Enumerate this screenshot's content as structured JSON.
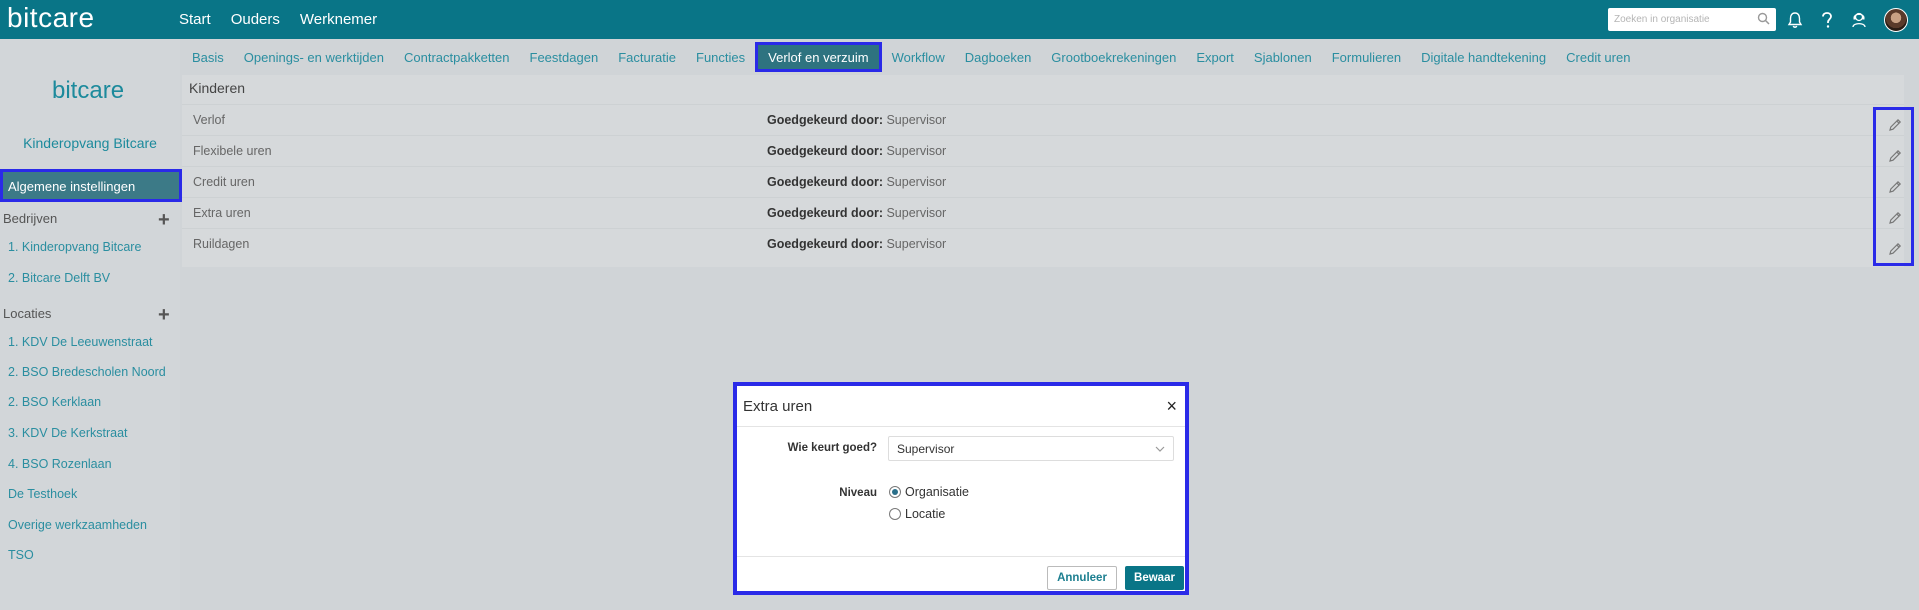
{
  "topbar": {
    "logo": "bitcare",
    "nav": [
      "Start",
      "Ouders",
      "Werknemer"
    ],
    "search_placeholder": "Zoeken in organisatie"
  },
  "sidebar": {
    "logo": "bitcare",
    "org_name": "Kinderopvang Bitcare",
    "settings_label": "Algemene instellingen",
    "companies_label": "Bedrijven",
    "companies": [
      "1. Kinderopvang Bitcare",
      "2. Bitcare Delft BV"
    ],
    "locations_label": "Locaties",
    "locations": [
      "1. KDV De Leeuwenstraat",
      "2. BSO Bredescholen Noord",
      "2. BSO Kerklaan",
      "3. KDV De Kerkstraat",
      "4. BSO Rozenlaan",
      "De Testhoek",
      "Overige werkzaamheden",
      "TSO"
    ]
  },
  "subnav": {
    "tabs": [
      "Basis",
      "Openings- en werktijden",
      "Contractpakketten",
      "Feestdagen",
      "Facturatie",
      "Functies",
      "Verlof en verzuim",
      "Workflow",
      "Dagboeken",
      "Grootboekrekeningen",
      "Export",
      "Sjablonen",
      "Formulieren",
      "Digitale handtekening",
      "Credit uren"
    ],
    "active_index": 6
  },
  "panel": {
    "heading": "Kinderen",
    "approved_label": "Goedgekeurd door:",
    "rows": [
      {
        "name": "Verlof",
        "approver": "Supervisor"
      },
      {
        "name": "Flexibele uren",
        "approver": "Supervisor"
      },
      {
        "name": "Credit uren",
        "approver": "Supervisor"
      },
      {
        "name": "Extra uren",
        "approver": "Supervisor"
      },
      {
        "name": "Ruildagen",
        "approver": "Supervisor"
      }
    ]
  },
  "modal": {
    "title": "Extra uren",
    "close": "×",
    "approver_label": "Wie keurt goed?",
    "approver_value": "Supervisor",
    "level_label": "Niveau",
    "options": [
      {
        "label": "Organisatie",
        "selected": true
      },
      {
        "label": "Locatie",
        "selected": false
      }
    ],
    "cancel_label": "Annuleer",
    "save_label": "Bewaar"
  },
  "colors": {
    "brand": "#097587",
    "link": "#2a8ea0",
    "highlight": "#2a2ae8"
  }
}
